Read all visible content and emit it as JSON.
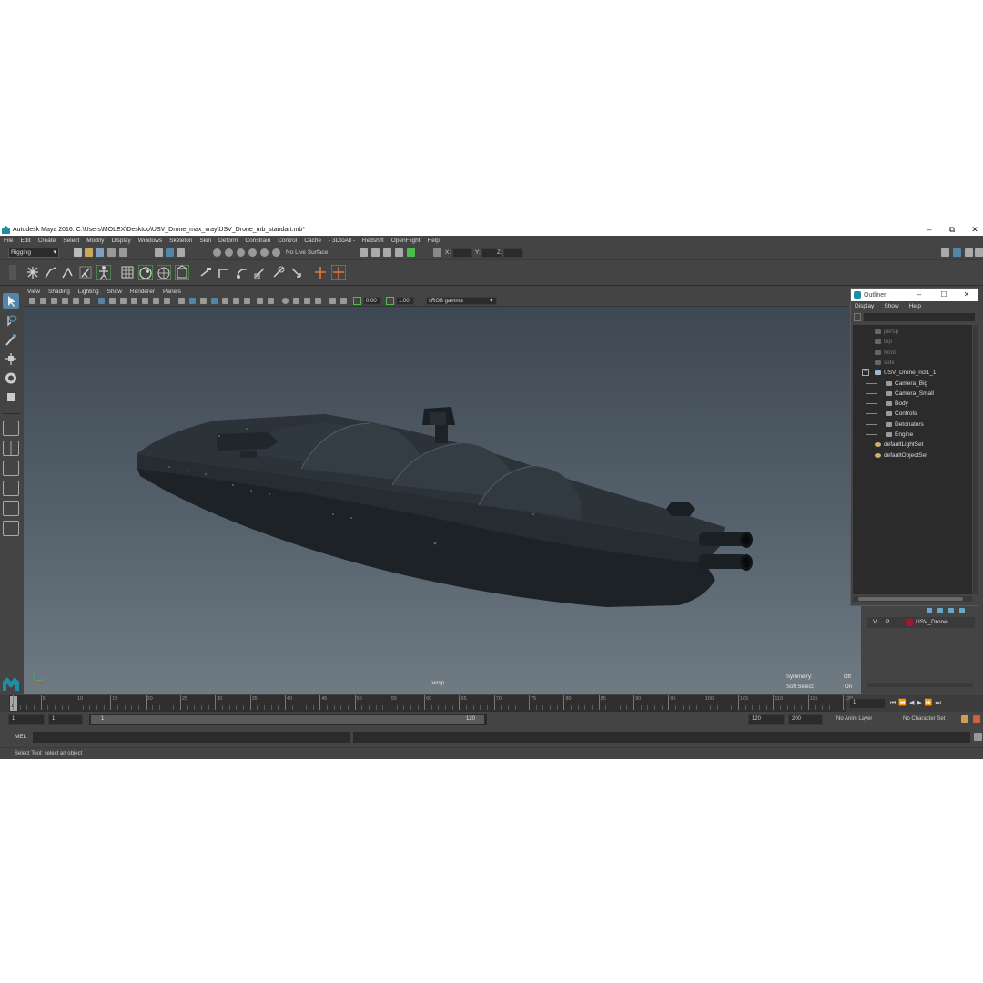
{
  "window": {
    "title": "Autodesk Maya 2016: C:\\Users\\MOLEX\\Desktop\\USV_Drone_max_vray\\USV_Drone_mb_standart.mb*",
    "minimize": "–",
    "maximize": "⧉",
    "close": "✕"
  },
  "menu": [
    "File",
    "Edit",
    "Create",
    "Select",
    "Modify",
    "Display",
    "Windows",
    "Skeleton",
    "Skin",
    "Deform",
    "Constrain",
    "Control",
    "Cache",
    "- 3DtoAll -",
    "Redshift",
    "OpenFlight",
    "Help"
  ],
  "statusline": {
    "mode": "Rigging",
    "live_surface": "No Live Surface",
    "x_label": "X:",
    "y_label": "Y:",
    "z_label": "Z:"
  },
  "viewport": {
    "menu": [
      "View",
      "Shading",
      "Lighting",
      "Show",
      "Renderer",
      "Panels"
    ],
    "exposure": "0.00",
    "gamma": "1.00",
    "color_space": "sRGB gamma",
    "camera_label": "persp",
    "symmetry_label": "Symmetry:",
    "symmetry_value": "Off",
    "soft_select_label": "Soft Select:",
    "soft_select_value": "On"
  },
  "outliner": {
    "title": "Outliner",
    "menu": [
      "Display",
      "Show",
      "Help"
    ],
    "items": [
      {
        "label": "persp",
        "indent": 0,
        "dim": true,
        "icon": "camera-icon"
      },
      {
        "label": "top",
        "indent": 0,
        "dim": true,
        "icon": "camera-icon"
      },
      {
        "label": "front",
        "indent": 0,
        "dim": true,
        "icon": "camera-icon"
      },
      {
        "label": "side",
        "indent": 0,
        "dim": true,
        "icon": "camera-icon"
      },
      {
        "label": "USV_Drone_ncl1_1",
        "indent": 0,
        "dim": false,
        "icon": "group-icon"
      },
      {
        "label": "Camera_Big",
        "indent": 1,
        "dim": false,
        "icon": "transform-icon"
      },
      {
        "label": "Camera_Small",
        "indent": 1,
        "dim": false,
        "icon": "transform-icon"
      },
      {
        "label": "Body",
        "indent": 1,
        "dim": false,
        "icon": "transform-icon"
      },
      {
        "label": "Controls",
        "indent": 1,
        "dim": false,
        "icon": "transform-icon"
      },
      {
        "label": "Detonators",
        "indent": 1,
        "dim": false,
        "icon": "transform-icon"
      },
      {
        "label": "Engine",
        "indent": 1,
        "dim": false,
        "icon": "transform-icon"
      },
      {
        "label": "defaultLightSet",
        "indent": 0,
        "dim": false,
        "icon": "set-icon"
      },
      {
        "label": "defaultObjectSet",
        "indent": 0,
        "dim": false,
        "icon": "set-icon"
      }
    ]
  },
  "layers": {
    "visible": "V",
    "playback": "P",
    "layer_name": "USV_Drone",
    "layer_color": "#a0182c"
  },
  "timeline": {
    "ticks": [
      "1",
      "5",
      "10",
      "15",
      "20",
      "25",
      "30",
      "35",
      "40",
      "45",
      "50",
      "55",
      "60",
      "65",
      "70",
      "75",
      "80",
      "85",
      "90",
      "95",
      "100",
      "105",
      "110",
      "115",
      "120"
    ],
    "current_frame": "1",
    "current_frame_field": "1"
  },
  "range": {
    "start": "1",
    "start_inner": "1",
    "slider_start": "1",
    "slider_end": "120",
    "end_inner": "120",
    "end": "200",
    "anim_layer": "No Anim Layer",
    "character_set": "No Character Set"
  },
  "command": {
    "language": "MEL"
  },
  "help": "Select Tool: select an object",
  "colors": {
    "accent": "#1c8fa0",
    "highlight": "#5285a6",
    "shelf_green": "#4bbf4b"
  }
}
